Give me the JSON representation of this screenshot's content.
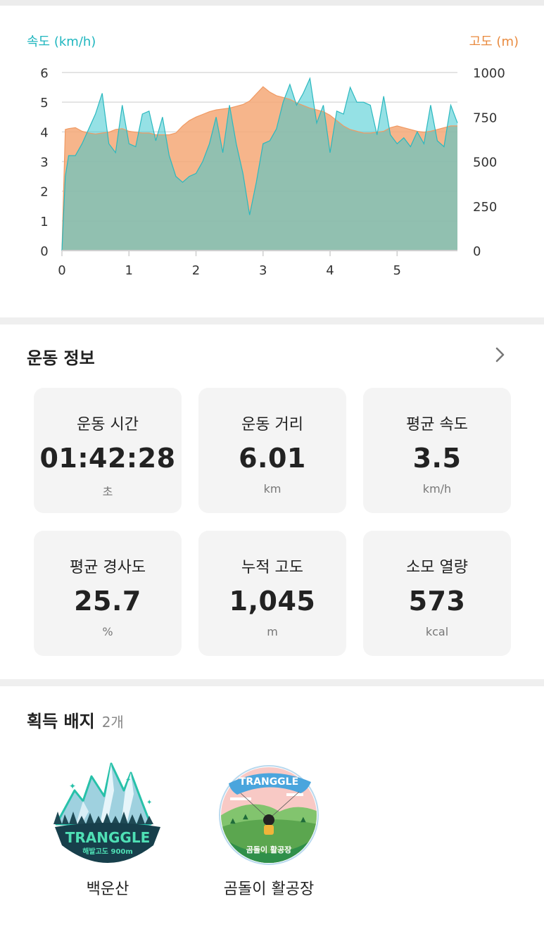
{
  "chart": {
    "left_axis_title": "속도 (km/h)",
    "right_axis_title": "고도 (m)",
    "colors": {
      "speed": "#3ec8cf",
      "altitude": "#f5a877",
      "speed_title": "#1fb6bf",
      "altitude_title": "#e98a3e"
    }
  },
  "chart_data": {
    "type": "area",
    "x": [
      0,
      0.05,
      0.1,
      0.2,
      0.3,
      0.4,
      0.5,
      0.6,
      0.7,
      0.8,
      0.9,
      1.0,
      1.1,
      1.2,
      1.3,
      1.4,
      1.5,
      1.6,
      1.7,
      1.8,
      1.9,
      2.0,
      2.1,
      2.2,
      2.3,
      2.4,
      2.5,
      2.6,
      2.7,
      2.8,
      2.9,
      3.0,
      3.1,
      3.2,
      3.3,
      3.4,
      3.5,
      3.6,
      3.7,
      3.8,
      3.9,
      4.0,
      4.1,
      4.2,
      4.3,
      4.4,
      4.5,
      4.6,
      4.7,
      4.8,
      4.9,
      5.0,
      5.1,
      5.2,
      5.3,
      5.4,
      5.5,
      5.6,
      5.7,
      5.8,
      5.9
    ],
    "series": [
      {
        "name": "속도 (km/h)",
        "axis": "left",
        "values": [
          0,
          2.5,
          3.2,
          3.2,
          3.6,
          4.1,
          4.6,
          5.3,
          3.6,
          3.3,
          4.9,
          3.6,
          3.5,
          4.6,
          4.7,
          3.7,
          4.5,
          3.2,
          2.5,
          2.3,
          2.5,
          2.6,
          3.0,
          3.6,
          4.5,
          3.3,
          4.9,
          3.6,
          2.6,
          1.2,
          2.3,
          3.6,
          3.7,
          4.1,
          5.0,
          5.6,
          4.9,
          5.3,
          5.8,
          4.3,
          4.9,
          3.3,
          4.7,
          4.6,
          5.5,
          5.0,
          5.0,
          4.9,
          3.9,
          5.2,
          3.9,
          3.6,
          3.8,
          3.5,
          4.0,
          3.6,
          4.9,
          3.7,
          3.5,
          4.9,
          4.3
        ]
      },
      {
        "name": "고도 (m)",
        "axis": "right",
        "values": [
          0,
          680,
          685,
          690,
          670,
          660,
          655,
          660,
          665,
          680,
          685,
          670,
          665,
          660,
          660,
          650,
          650,
          650,
          660,
          700,
          730,
          750,
          765,
          780,
          790,
          795,
          800,
          810,
          820,
          840,
          880,
          920,
          890,
          870,
          860,
          850,
          830,
          815,
          800,
          790,
          780,
          760,
          730,
          700,
          680,
          670,
          660,
          660,
          665,
          670,
          690,
          700,
          690,
          680,
          670,
          665,
          670,
          680,
          690,
          700,
          700
        ]
      }
    ],
    "xlim": [
      0,
      5.9
    ],
    "ylim_left": [
      0,
      6
    ],
    "ylim_right": [
      0,
      1000
    ],
    "x_ticks": [
      "0",
      "1",
      "2",
      "3",
      "4",
      "5"
    ],
    "y_ticks_left": [
      "0",
      "1",
      "2",
      "3",
      "4",
      "5",
      "6"
    ],
    "y_ticks_right": [
      "0",
      "250",
      "500",
      "750",
      "1000"
    ],
    "left_label": "속도 (km/h)",
    "right_label": "고도 (m)",
    "grid": true
  },
  "stats": {
    "title": "운동 정보",
    "tiles": [
      {
        "label": "운동 시간",
        "value": "01:42:28",
        "unit": "초"
      },
      {
        "label": "운동 거리",
        "value": "6.01",
        "unit": "km"
      },
      {
        "label": "평균 속도",
        "value": "3.5",
        "unit": "km/h"
      },
      {
        "label": "평균 경사도",
        "value": "25.7",
        "unit": "%"
      },
      {
        "label": "누적 고도",
        "value": "1,045",
        "unit": "m"
      },
      {
        "label": "소모 열량",
        "value": "573",
        "unit": "kcal"
      }
    ]
  },
  "badges": {
    "title": "획득 배지",
    "count": "2개",
    "items": [
      {
        "name": "백운산",
        "emblem_text": "TRANGGLE",
        "emblem_sub": "해발고도 900m",
        "icon": "mountain-badge-icon"
      },
      {
        "name": "곰돌이 활공장",
        "emblem_text": "TRANGGLE",
        "emblem_sub": "곰돌이 활공장",
        "icon": "paraglider-badge-icon"
      }
    ]
  }
}
